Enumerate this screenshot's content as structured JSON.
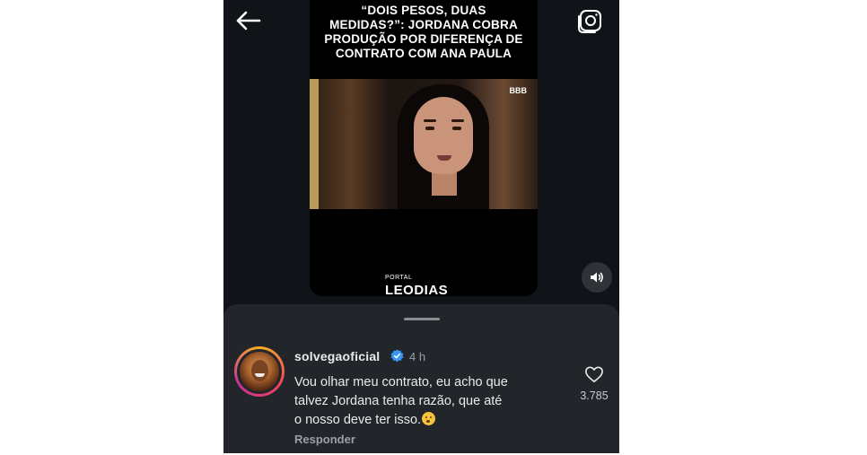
{
  "video": {
    "headline": "“DOIS PESOS, DUAS\nMEDIDAS?”: JORDANA COBRA\nPRODUÇÃO POR DIFERENÇA DE\nCONTRATO COM ANA PAULA",
    "watermark": "BBB",
    "portal_label": "PORTAL",
    "brand": "LEODIAS"
  },
  "comment": {
    "username": "solvegaoficial",
    "time": "4 h",
    "text_lines": [
      "Vou olhar meu contrato, eu acho que",
      "talvez Jordana tenha razão, que até",
      "o nosso deve ter isso."
    ],
    "reply_label": "Responder",
    "like_count": "3.785"
  },
  "icons": {
    "back": "arrow-left-icon",
    "camera": "camera-icon",
    "volume": "volume-icon",
    "verified": "verified-badge-icon",
    "like": "heart-icon",
    "emoji": "hushed-face-emoji"
  },
  "colors": {
    "background": "#101418",
    "sheet": "#22262b",
    "text": "#e8eaed",
    "muted": "#9aa0a6",
    "verified": "#3897f0"
  }
}
